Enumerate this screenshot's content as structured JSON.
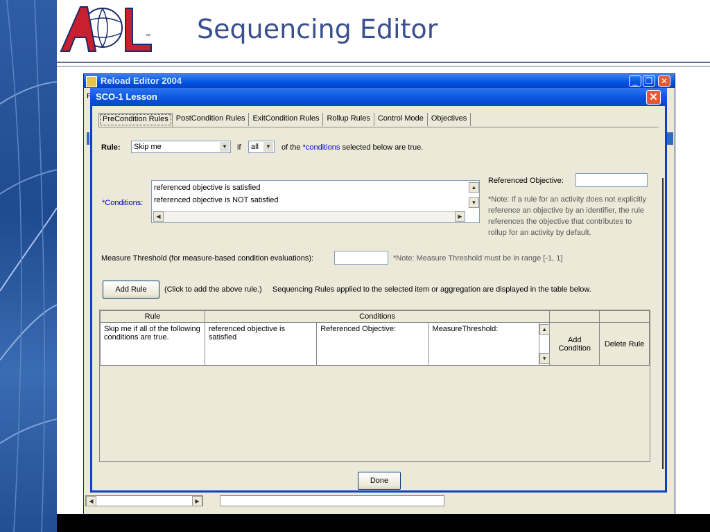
{
  "slide": {
    "title": "Sequencing Editor",
    "logo_text": "ADL",
    "logo_tm": "™"
  },
  "reload_window": {
    "title": "Reload Editor 2004",
    "menu_letter": "F"
  },
  "dialog": {
    "title": "SCO-1 Lesson",
    "tabs": [
      "PreCondition Rules",
      "PostCondition Rules",
      "ExitCondition Rules",
      "Rollup Rules",
      "Control Mode",
      "Objectives"
    ],
    "rule_label": "Rule:",
    "rule_value": "Skip me",
    "if_label": "if",
    "all_value": "all",
    "of_the": "of the",
    "conditions_link": "*conditions",
    "selected_text": "selected below are true.",
    "conditions_label": "*Conditions:",
    "conditions_items": [
      "referenced objective is satisfied",
      "referenced objective is NOT satisfied"
    ],
    "referenced_objective_label": "Referenced Objective:",
    "referenced_objective_value": "",
    "note_lines": [
      "*Note: If a rule for an activity does not explicitly",
      "reference an objective by an identifier, the rule",
      "references the objective that contributes to",
      "rollup for an activity by default."
    ],
    "measure_label": "Measure Threshold (for measure-based condition evaluations):",
    "measure_value": "",
    "measure_note": "*Note: Measure Threshold must be in range [-1, 1]",
    "add_rule_button": "Add Rule",
    "add_rule_hint": "(Click to add the above rule.)     Sequencing Rules applied to the selected item or aggregation are displayed in the table below.",
    "table": {
      "headers": [
        "Rule",
        "Conditions"
      ],
      "row": {
        "rule": "Skip me if all of the following conditions are true.",
        "condition": "referenced objective is satisfied",
        "ref_objective": "Referenced Objective:",
        "measure": "MeasureThreshold:",
        "add_condition": "Add Condition",
        "delete_rule": "Delete Rule"
      }
    },
    "done_button": "Done"
  },
  "colors": {
    "title_blue": "#3a4f8f",
    "xp_blue": "#0a55e0",
    "dialog_bg": "#ece9d8",
    "link_blue": "#0000cc"
  }
}
